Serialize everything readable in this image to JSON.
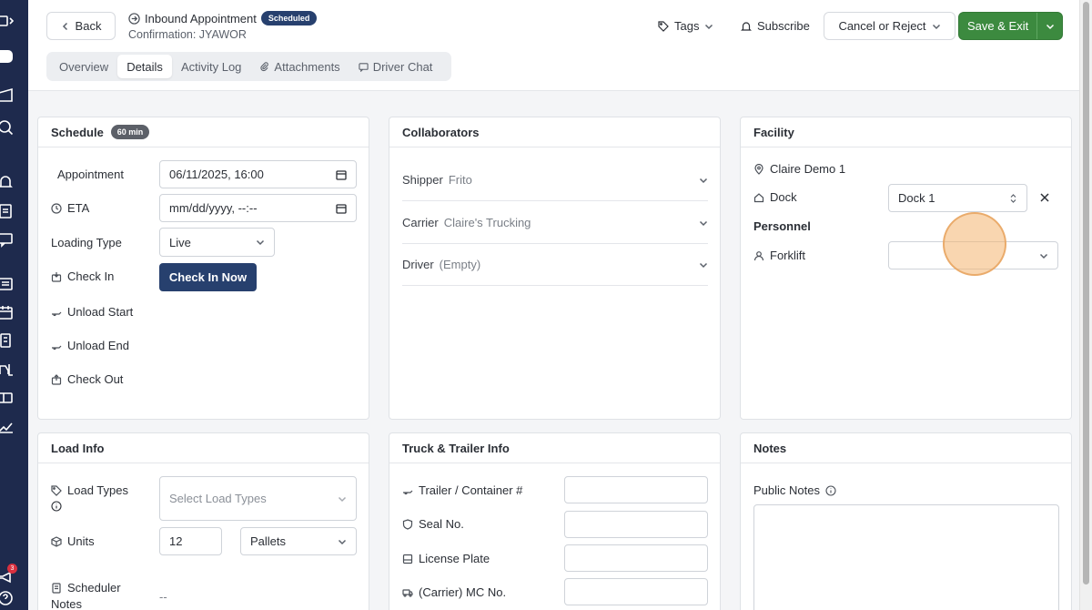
{
  "nav": {
    "notification_count": "3"
  },
  "header": {
    "back_label": "Back",
    "title": "Inbound Appointment",
    "status": "Scheduled",
    "confirmation": "Confirmation: JYAWOR",
    "tags_label": "Tags",
    "subscribe_label": "Subscribe",
    "cancel_label": "Cancel or Reject",
    "save_label": "Save & Exit",
    "tabs": [
      {
        "label": "Overview"
      },
      {
        "label": "Details"
      },
      {
        "label": "Activity Log"
      },
      {
        "label": "Attachments"
      },
      {
        "label": "Driver Chat"
      }
    ]
  },
  "schedule": {
    "title": "Schedule",
    "duration": "60 min",
    "appointment_label": "Appointment",
    "appointment_value": "06/11/2025, 16:00",
    "eta_label": "ETA",
    "eta_value": "mm/dd/yyyy, --:--",
    "loading_type_label": "Loading Type",
    "loading_type_value": "Live",
    "check_in_label": "Check In",
    "check_in_button": "Check In Now",
    "unload_start_label": "Unload Start",
    "unload_end_label": "Unload End",
    "check_out_label": "Check Out"
  },
  "collaborators": {
    "title": "Collaborators",
    "rows": [
      {
        "label": "Shipper",
        "value": "Frito"
      },
      {
        "label": "Carrier",
        "value": "Claire's Trucking"
      },
      {
        "label": "Driver",
        "value": "(Empty)"
      }
    ]
  },
  "facility": {
    "title": "Facility",
    "location": "Claire Demo 1",
    "dock_label": "Dock",
    "dock_value": "Dock 1",
    "personnel_label": "Personnel",
    "forklift_label": "Forklift",
    "forklift_value": ""
  },
  "load_info": {
    "title": "Load Info",
    "load_types_label": "Load Types",
    "load_types_placeholder": "Select Load Types",
    "units_label": "Units",
    "units_value": "12",
    "units_type": "Pallets",
    "scheduler_notes_label_1": "Scheduler",
    "scheduler_notes_label_2": "Notes",
    "scheduler_notes_value": "--"
  },
  "truck": {
    "title": "Truck & Trailer Info",
    "trailer_label": "Trailer / Container #",
    "seal_label": "Seal No.",
    "plate_label": "License Plate",
    "mc_label": "(Carrier) MC No."
  },
  "notes": {
    "title": "Notes",
    "public_label": "Public Notes"
  },
  "colors": {
    "nav": "#1e2a4d",
    "primary": "#27406e",
    "save": "#3c8a3f"
  }
}
